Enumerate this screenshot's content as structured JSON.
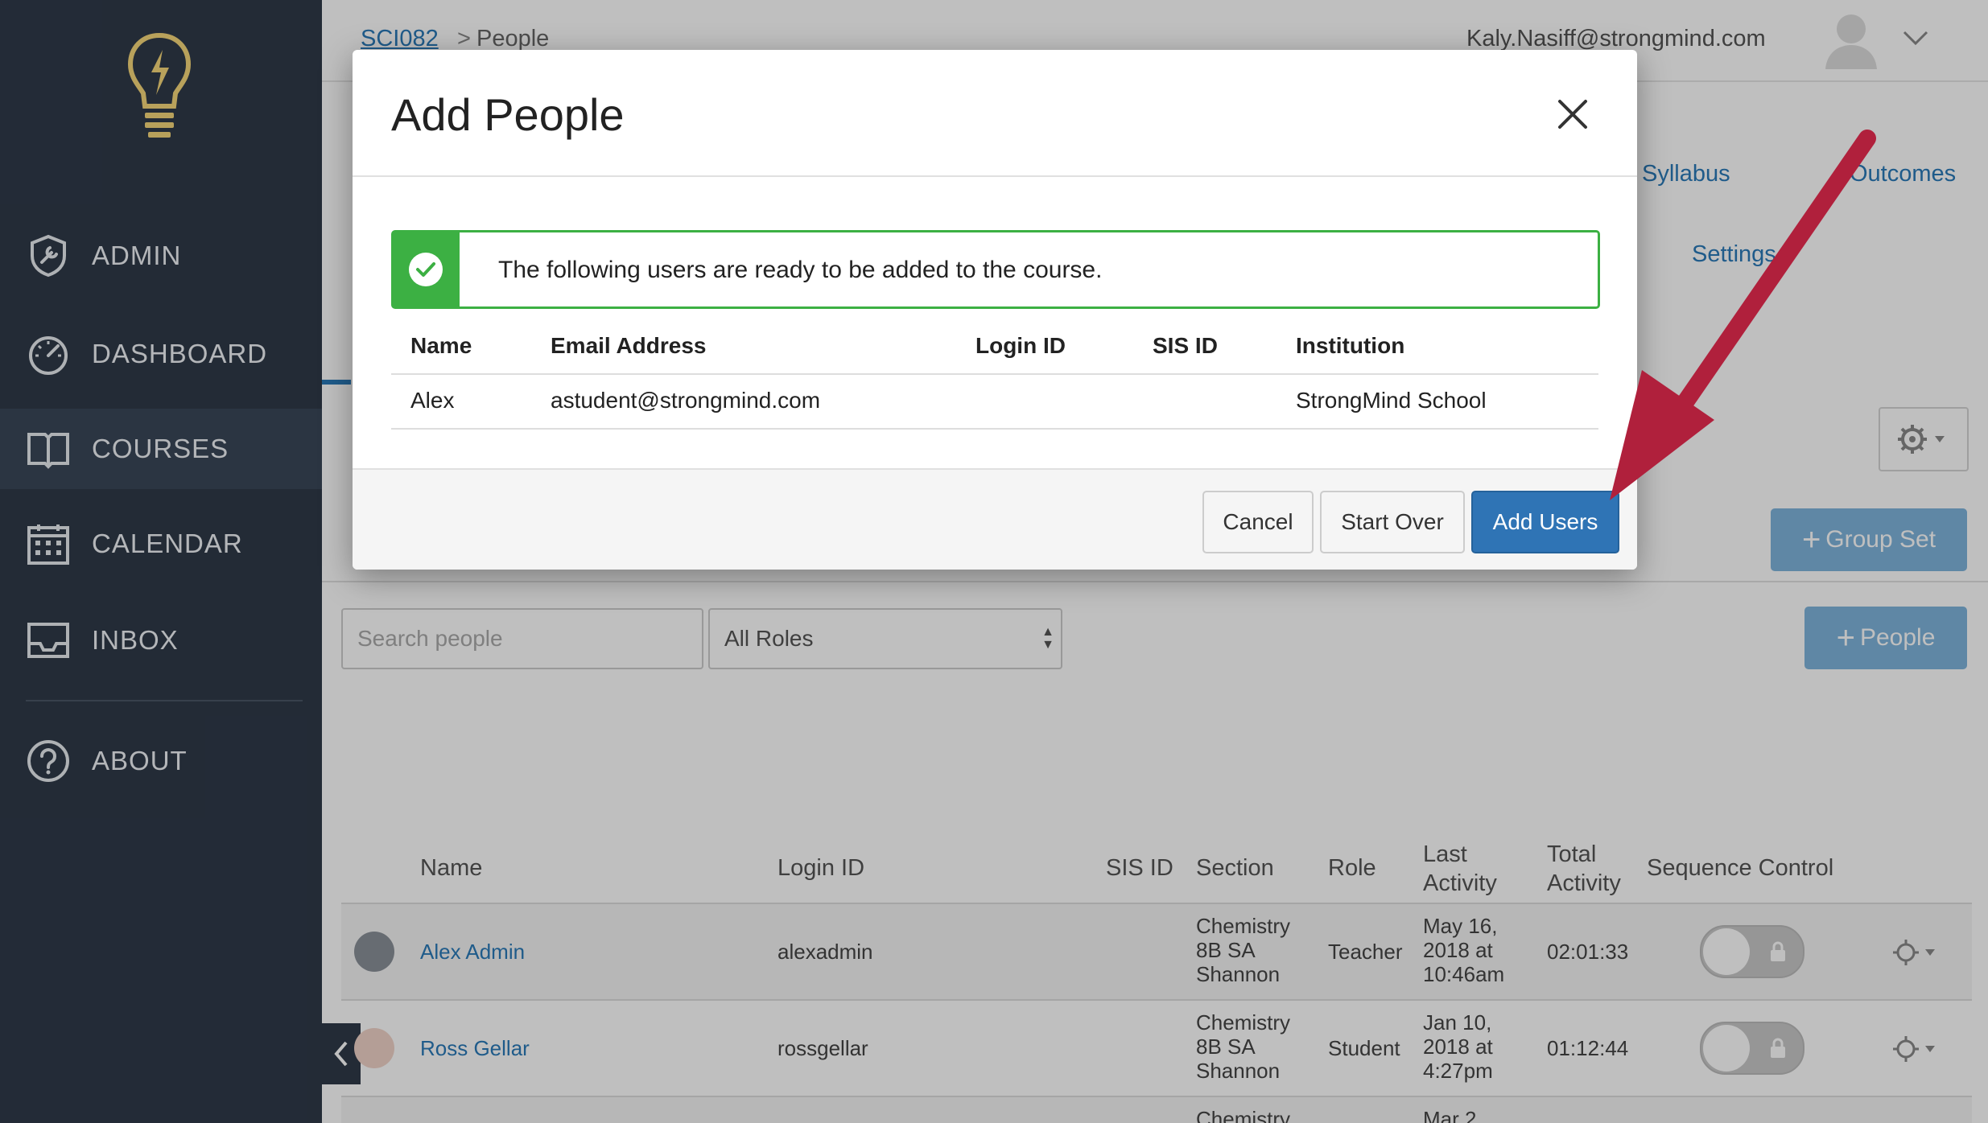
{
  "sidebar": {
    "items": [
      {
        "label": "ADMIN",
        "icon": "shield-wrench-icon"
      },
      {
        "label": "DASHBOARD",
        "icon": "speedometer-icon"
      },
      {
        "label": "COURSES",
        "icon": "open-book-icon",
        "active": true
      },
      {
        "label": "CALENDAR",
        "icon": "calendar-icon"
      },
      {
        "label": "INBOX",
        "icon": "inbox-tray-icon"
      },
      {
        "label": "ABOUT",
        "icon": "question-circle-icon"
      }
    ]
  },
  "header": {
    "breadcrumb_course": "SCI082",
    "breadcrumb_separator": ">",
    "breadcrumb_current": "People",
    "user_email": "Kaly.Nasiff@strongmind.com"
  },
  "course_tabs": {
    "syllabus": "Syllabus",
    "outcomes": "Outcomes",
    "settings": "Settings"
  },
  "people_page": {
    "group_set_label": "Group Set",
    "people_button_label": "People",
    "search_placeholder": "Search people",
    "role_filter_value": "All Roles",
    "columns": [
      "Name",
      "Login ID",
      "SIS ID",
      "Section",
      "Role",
      "Last Activity",
      "Total Activity",
      "Sequence Control"
    ],
    "rows": [
      {
        "name": "Alex Admin",
        "login_id": "alexadmin",
        "section": "Chemistry 8B SA Shannon",
        "role": "Teacher",
        "last_activity": "May 16, 2018 at 10:46am",
        "total_activity": "02:01:33"
      },
      {
        "name": "Ross Gellar",
        "login_id": "rossgellar",
        "section": "Chemistry 8B SA Shannon",
        "role": "Student",
        "last_activity": "Jan 10, 2018 at 4:27pm",
        "total_activity": "01:12:44"
      },
      {
        "name": "",
        "login_id": "",
        "section": "Chemistry",
        "role": "",
        "last_activity": "Mar 2,",
        "total_activity": ""
      }
    ]
  },
  "modal": {
    "title": "Add People",
    "alert_text": "The following users are ready to be added to the course.",
    "columns": [
      "Name",
      "Email Address",
      "Login ID",
      "SIS ID",
      "Institution"
    ],
    "users": [
      {
        "name": "Alex",
        "email": "astudent@strongmind.com",
        "login_id": "",
        "sis_id": "",
        "institution": "StrongMind School"
      }
    ],
    "buttons": {
      "cancel": "Cancel",
      "start_over": "Start Over",
      "add_users": "Add Users"
    }
  },
  "colors": {
    "sidebar_bg": "#2f3a49",
    "success_green": "#3cb043",
    "primary_blue": "#2f74b5",
    "annotation_arrow": "#b0203c"
  }
}
